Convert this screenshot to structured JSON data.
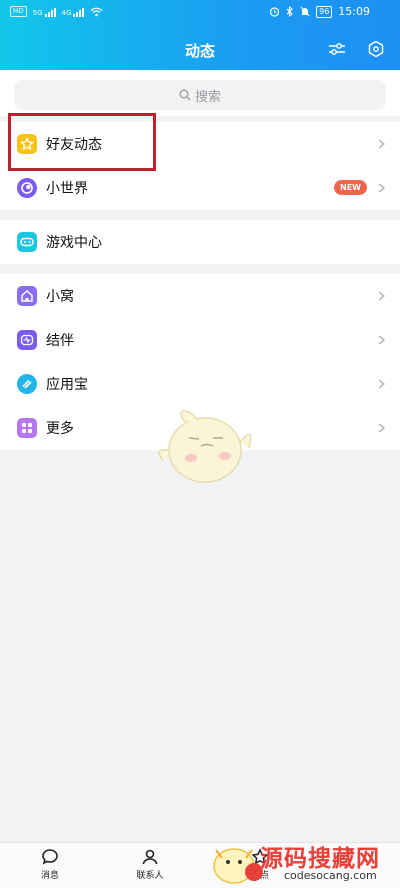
{
  "status_bar": {
    "chip1": "HD",
    "chip2": "5G",
    "chip3": "4G",
    "battery": "96",
    "time": "15:09"
  },
  "header": {
    "title": "动态",
    "icons": [
      "filter-icon",
      "hexagon-settings-icon"
    ]
  },
  "search": {
    "placeholder": "搜索"
  },
  "sections": [
    {
      "items": [
        {
          "label": "好友动态",
          "icon": "star-icon",
          "color": "#f7c31b",
          "chevron": true
        },
        {
          "label": "小世界",
          "icon": "small-world-icon",
          "color": "#7b5cf0",
          "badge": "NEW",
          "chevron": true
        }
      ]
    },
    {
      "items": [
        {
          "label": "游戏中心",
          "icon": "gamepad-icon",
          "color": "#1fc4e0",
          "chevron": false
        }
      ]
    },
    {
      "items": [
        {
          "label": "小窝",
          "icon": "house-icon",
          "color": "#8a6df0",
          "chevron": true
        },
        {
          "label": "结伴",
          "icon": "wave-icon",
          "color": "#7c5cf5",
          "chevron": true
        },
        {
          "label": "应用宝",
          "icon": "app-store-icon",
          "color": "#21b5e8",
          "chevron": true
        },
        {
          "label": "更多",
          "icon": "grid-icon",
          "color": "#b576f2",
          "chevron": true
        }
      ]
    }
  ],
  "tabbar": [
    {
      "label": "消息",
      "icon": "chat-bubble-icon"
    },
    {
      "label": "联系人",
      "icon": "person-icon"
    },
    {
      "label": "看点",
      "icon": "star-tab-icon"
    }
  ],
  "watermark": {
    "text": "源码搜藏网",
    "sub": "codesocang.com"
  },
  "colors": {
    "header_start": "#12c7ea",
    "header_end": "#1e8ff4",
    "highlight": "#c0202c",
    "badge": "#f0644c"
  }
}
